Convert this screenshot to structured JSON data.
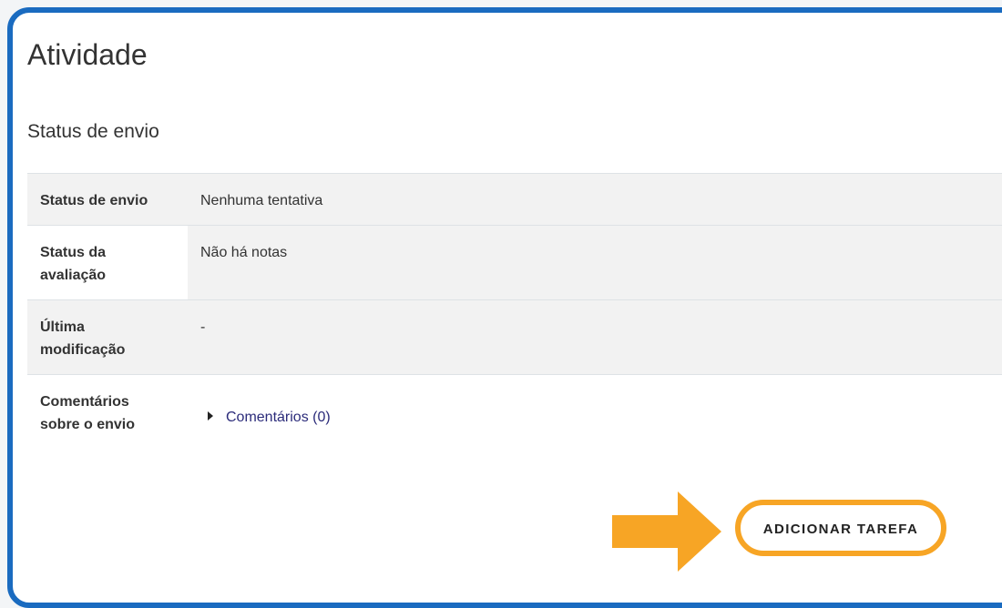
{
  "page": {
    "title": "Atividade"
  },
  "submission": {
    "section_title": "Status de envio",
    "rows": [
      {
        "label": "Status de envio",
        "value": "Nenhuma tentativa"
      },
      {
        "label": "Status da avaliação",
        "value": "Não há notas"
      },
      {
        "label": "Última modificação",
        "value": "-"
      },
      {
        "label": "Comentários sobre o envio",
        "value": "Comentários (0)"
      }
    ]
  },
  "actions": {
    "add_task_label": "ADICIONAR TAREFA"
  },
  "colors": {
    "frame_border": "#1a6bc0",
    "highlight": "#f7a525",
    "row_shade": "#f2f2f2",
    "link": "#2b2b7a"
  },
  "icons": {
    "comments_toggle": "caret-right-icon",
    "pointer": "arrow-right-icon"
  }
}
